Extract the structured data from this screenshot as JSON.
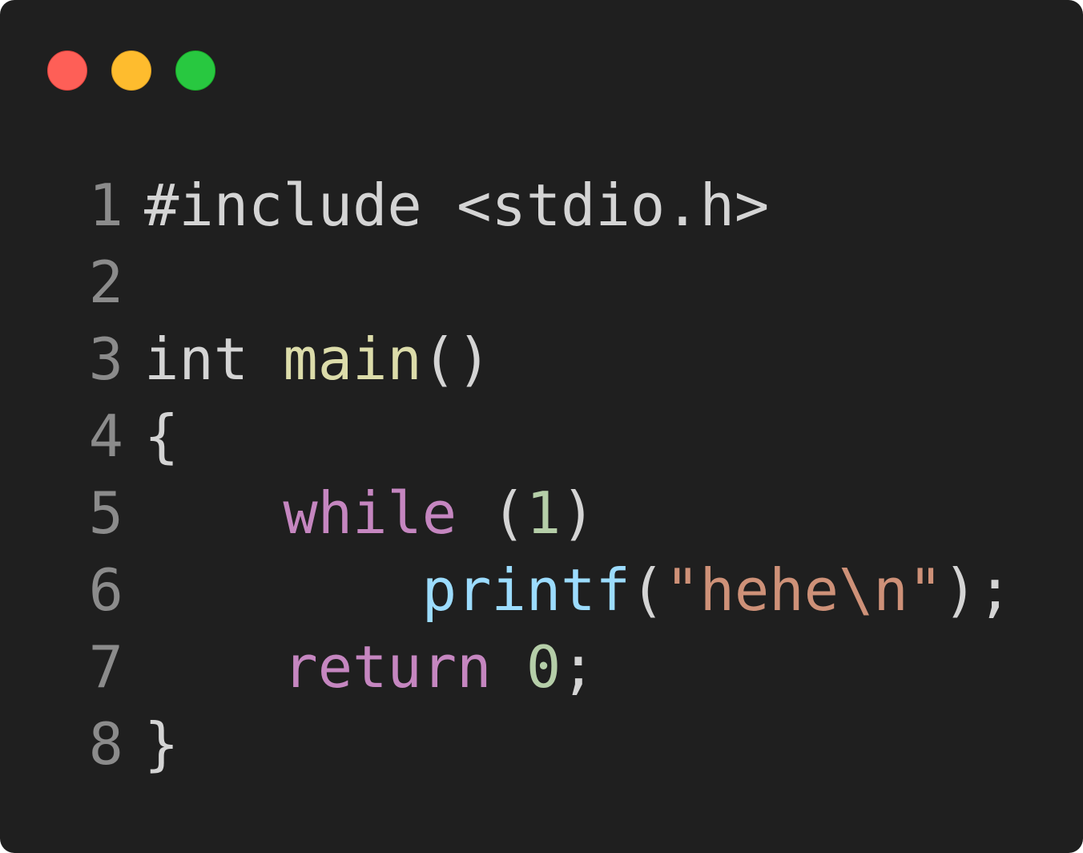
{
  "window": {
    "controls": [
      "close",
      "minimize",
      "maximize"
    ],
    "colors": {
      "background": "#1f1f1f",
      "close": "#fe5f57",
      "minimize": "#febc2e",
      "maximize": "#28c840"
    }
  },
  "code": {
    "lines": [
      {
        "number": "1",
        "tokens": [
          {
            "type": "plain",
            "text": "#include <stdio.h>"
          }
        ]
      },
      {
        "number": "2",
        "tokens": []
      },
      {
        "number": "3",
        "tokens": [
          {
            "type": "plain",
            "text": "int "
          },
          {
            "type": "func",
            "text": "main"
          },
          {
            "type": "plain",
            "text": "()"
          }
        ]
      },
      {
        "number": "4",
        "tokens": [
          {
            "type": "plain",
            "text": "{"
          }
        ]
      },
      {
        "number": "5",
        "tokens": [
          {
            "type": "plain",
            "text": "    "
          },
          {
            "type": "kw",
            "text": "while"
          },
          {
            "type": "plain",
            "text": " ("
          },
          {
            "type": "num",
            "text": "1"
          },
          {
            "type": "plain",
            "text": ")"
          }
        ]
      },
      {
        "number": "6",
        "tokens": [
          {
            "type": "plain",
            "text": "        "
          },
          {
            "type": "call",
            "text": "printf"
          },
          {
            "type": "plain",
            "text": "("
          },
          {
            "type": "str",
            "text": "\"hehe\\n\""
          },
          {
            "type": "plain",
            "text": ");"
          }
        ]
      },
      {
        "number": "7",
        "tokens": [
          {
            "type": "plain",
            "text": "    "
          },
          {
            "type": "kw",
            "text": "return"
          },
          {
            "type": "plain",
            "text": " "
          },
          {
            "type": "num",
            "text": "0"
          },
          {
            "type": "plain",
            "text": ";"
          }
        ]
      },
      {
        "number": "8",
        "tokens": [
          {
            "type": "plain",
            "text": "}"
          }
        ]
      }
    ],
    "token_colors": {
      "plain": "#d4d4d4",
      "func": "#dcdcaa",
      "kw": "#c586c0",
      "num": "#b5cea8",
      "call": "#9cdcfe",
      "str": "#ce9178",
      "line_number": "#8b8b8b"
    }
  }
}
